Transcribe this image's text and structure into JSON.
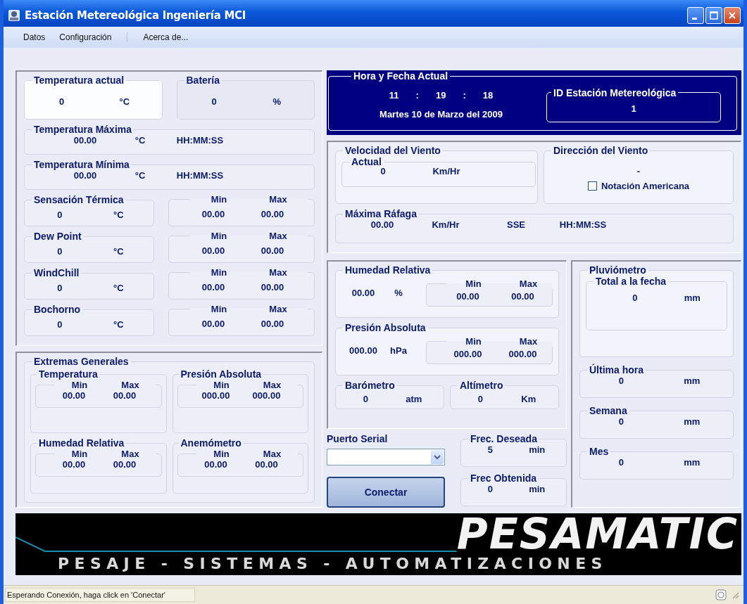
{
  "window": {
    "title": "Estación Metereológica Ingeniería MCI"
  },
  "menu": [
    {
      "kind": "item",
      "label": "Datos"
    },
    {
      "kind": "item",
      "label": "Configuración"
    },
    {
      "kind": "separator"
    },
    {
      "kind": "item",
      "label": "Acerca de..."
    }
  ],
  "current": [
    {
      "title": "Temperatura actual",
      "value": "0",
      "unit": "°C",
      "highlighted": true
    },
    {
      "title": "Batería",
      "value": "0",
      "unit": "%",
      "highlighted": false
    }
  ],
  "temperature_extremes": [
    {
      "title": "Temperatura Máxima",
      "value": "00.00",
      "unit": "°C",
      "time": "HH:MM:SS"
    },
    {
      "title": "Temperatura Mínima",
      "value": "00.00",
      "unit": "°C",
      "time": "HH:MM:SS"
    }
  ],
  "derived": [
    {
      "title": "Sensación Térmica",
      "value": "0",
      "unit": "°C",
      "min_label": "Min",
      "max_label": "Max",
      "min": "00.00",
      "max": "00.00"
    },
    {
      "title": "Dew Point",
      "value": "0",
      "unit": "°C",
      "min_label": "Min",
      "max_label": "Max",
      "min": "00.00",
      "max": "00.00"
    },
    {
      "title": "WindChill",
      "value": "0",
      "unit": "°C",
      "min_label": "Min",
      "max_label": "Max",
      "min": "00.00",
      "max": "00.00"
    },
    {
      "title": "Bochorno",
      "value": "0",
      "unit": "°C",
      "min_label": "Min",
      "max_label": "Max",
      "min": "00.00",
      "max": "00.00"
    }
  ],
  "general_extremes": {
    "title": "Extremas Generales",
    "groups": [
      {
        "title": "Temperatura",
        "min_label": "Min",
        "max_label": "Max",
        "min": "00.00",
        "max": "00.00"
      },
      {
        "title": "Presión Absoluta",
        "min_label": "Min",
        "max_label": "Max",
        "min": "000.00",
        "max": "000.00"
      },
      {
        "title": "Humedad Relativa",
        "min_label": "Min",
        "max_label": "Max",
        "min": "00.00",
        "max": "00.00"
      },
      {
        "title": "Anemómetro",
        "min_label": "Min",
        "max_label": "Max",
        "min": "00.00",
        "max": "00.00"
      }
    ]
  },
  "clock": {
    "title": "Hora y Fecha Actual",
    "time": [
      "11",
      ":",
      "19",
      ":",
      "18"
    ],
    "date": "Martes 10 de Marzo del 2009",
    "station": {
      "title": "ID Estación Metereológica",
      "value": "1"
    }
  },
  "wind": {
    "speed": {
      "title": "Velocidad del Viento",
      "current": {
        "title": "Actual",
        "value": "0",
        "unit": "Km/Hr"
      }
    },
    "direction": {
      "title": "Dirección del Viento",
      "value": "-",
      "checkbox": {
        "label": "Notación Americana",
        "checked": false
      }
    },
    "gust": {
      "title": "Máxima Ráfaga",
      "value": "00.00",
      "unit": "Km/Hr",
      "direction": "SSE",
      "time": "HH:MM:SS"
    }
  },
  "humidity": {
    "title": "Humedad Relativa",
    "value": "00.00",
    "unit": "%",
    "min_label": "Min",
    "max_label": "Max",
    "min": "00.00",
    "max": "00.00"
  },
  "pressure": {
    "title": "Presión Absoluta",
    "value": "000.00",
    "unit": "hPa",
    "min_label": "Min",
    "max_label": "Max",
    "min": "000.00",
    "max": "000.00"
  },
  "instruments": [
    {
      "title": "Barómetro",
      "value": "0",
      "unit": "atm"
    },
    {
      "title": "Altímetro",
      "value": "0",
      "unit": "Km"
    }
  ],
  "serial": {
    "label": "Puerto Serial",
    "button": "Conectar"
  },
  "frequencies": [
    {
      "title": "Frec. Deseada",
      "value": "5",
      "unit": "min"
    },
    {
      "title": "Frec Obtenida",
      "value": "0",
      "unit": "min"
    }
  ],
  "rain": {
    "title": "Pluviómetro",
    "total": {
      "title": "Total a la fecha",
      "value": "0",
      "unit": "mm"
    },
    "periods": [
      {
        "title": "Última hora",
        "value": "0",
        "unit": "mm"
      },
      {
        "title": "Semana",
        "value": "0",
        "unit": "mm"
      },
      {
        "title": "Mes",
        "value": "0",
        "unit": "mm"
      }
    ]
  },
  "banner": {
    "brand": "PESAMATIC",
    "tagline": "PESAJE - SISTEMAS - AUTOMATIZACIONES"
  },
  "status_bar": {
    "text": "Esperando Conexión, haga click en 'Conectar'"
  }
}
